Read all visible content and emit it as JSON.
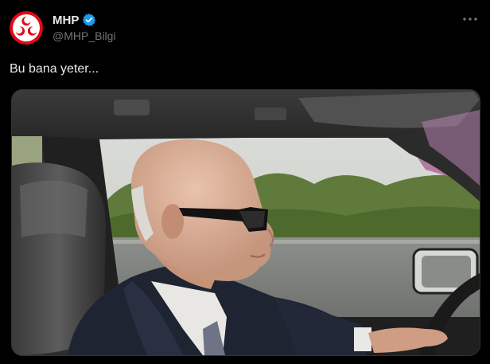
{
  "author": {
    "display_name": "MHP",
    "handle": "@MHP_Bilgi",
    "verified": true,
    "avatar_icon": "mhp-crescents-logo",
    "brand_color": "#e30a17",
    "verified_color": "#1d9bf0"
  },
  "tweet": {
    "text": "Bu bana yeter...",
    "more_icon": "more-horizontal-icon"
  },
  "media": {
    "type": "photo",
    "subject_icon": "car-interior-photo"
  },
  "colors": {
    "background": "#000000",
    "text_primary": "#e7e9ea",
    "text_secondary": "#71767b"
  }
}
